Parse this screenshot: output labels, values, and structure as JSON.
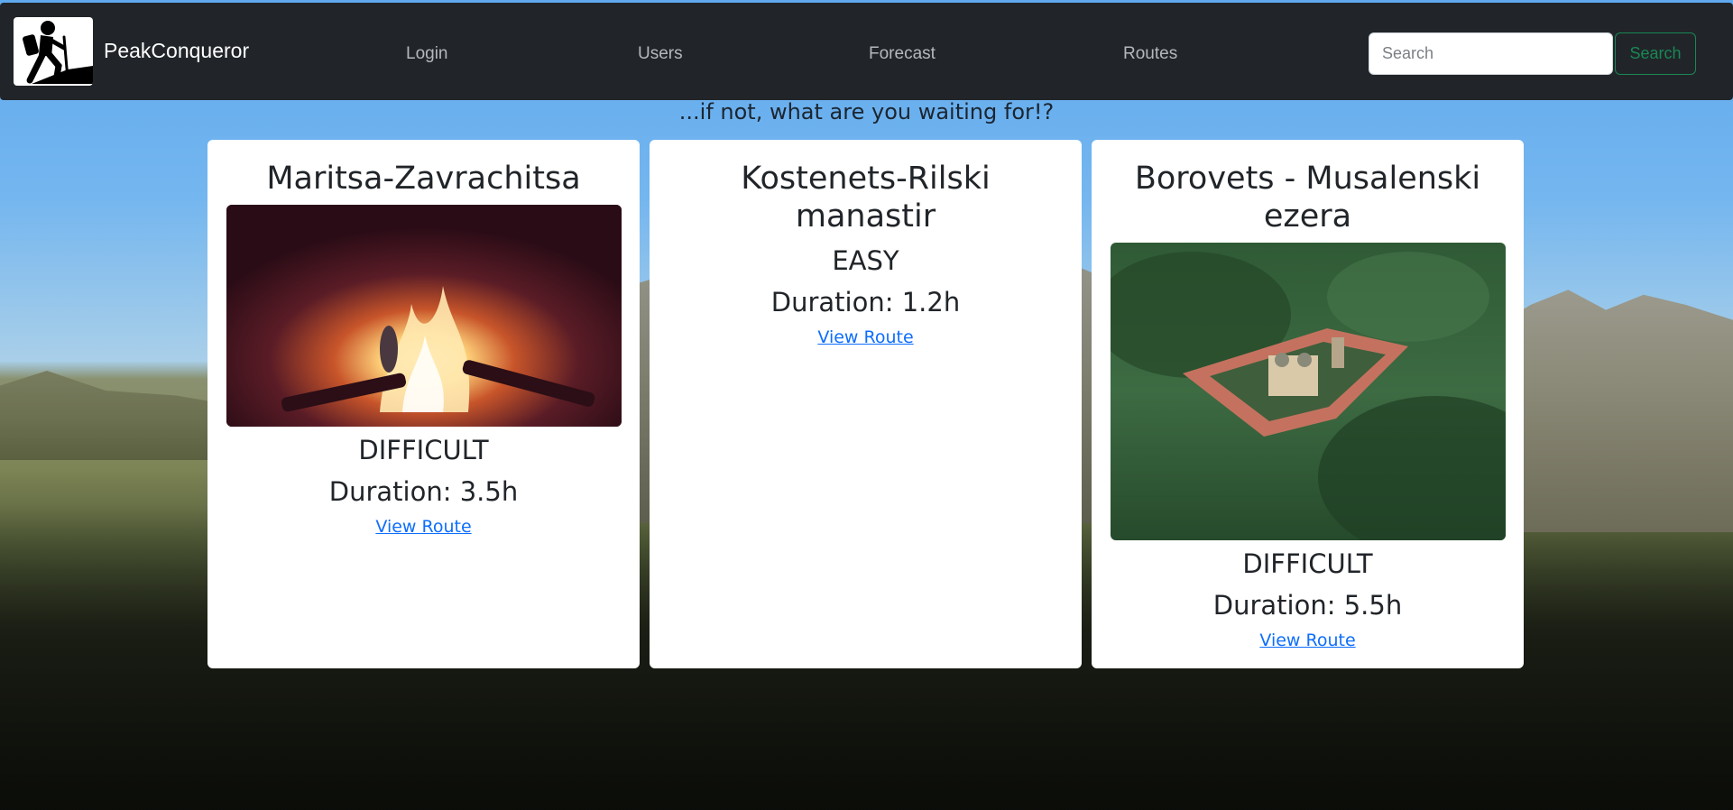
{
  "navbar": {
    "brand": "PeakConqueror",
    "links": [
      {
        "label": "Login"
      },
      {
        "label": "Users"
      },
      {
        "label": "Forecast"
      },
      {
        "label": "Routes"
      }
    ],
    "search": {
      "placeholder": "Search",
      "value": "",
      "button_label": "Search"
    }
  },
  "tagline": "...if not, what are you waiting for!?",
  "cards": [
    {
      "title": "Maritsa-Zavrachitsa",
      "image": "campfire-photo",
      "difficulty": "DIFFICULT",
      "duration": "Duration: 3.5h",
      "link_label": "View Route"
    },
    {
      "title": "Kostenets-Rilski manastir",
      "image": null,
      "difficulty": "EASY",
      "duration": "Duration: 1.2h",
      "link_label": "View Route"
    },
    {
      "title": "Borovets - Musalenski ezera",
      "image": "monastery-photo",
      "difficulty": "DIFFICULT",
      "duration": "Duration: 5.5h",
      "link_label": "View Route"
    }
  ],
  "colors": {
    "navbar_bg": "#212529",
    "nav_link": "#b5b8bb",
    "search_button": "#198754",
    "link": "#0d6efd",
    "card_bg": "#ffffff"
  }
}
